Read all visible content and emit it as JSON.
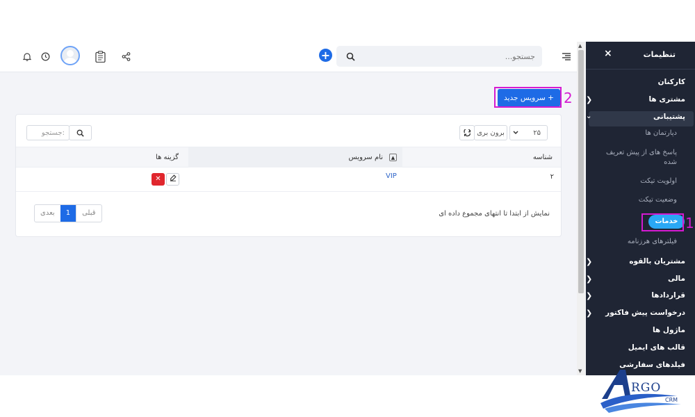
{
  "topbar": {
    "search_placeholder": "جستجو...",
    "icons": [
      "menu-icon",
      "search-icon",
      "add-icon",
      "share-icon",
      "clipboard-icon",
      "avatar",
      "clock-icon",
      "bell-icon"
    ]
  },
  "sidebar": {
    "title": "تنظیمات",
    "close": "×",
    "items": [
      {
        "label": "کارکنان"
      },
      {
        "label": "مشتری ها"
      },
      {
        "label": "پشتیبانی"
      },
      {
        "label": "دپارتمان ها"
      },
      {
        "label": "پاسخ های از پیش تعریف شده"
      },
      {
        "label": "اولویت تیکت"
      },
      {
        "label": "وضعیت تیکت"
      },
      {
        "label": "خدمات"
      },
      {
        "label": "فیلترهای هرزنامه"
      },
      {
        "label": "مشتریان بالقوه"
      },
      {
        "label": "مالی"
      },
      {
        "label": "قراردادها"
      },
      {
        "label": "درخواست پیش فاکتور"
      },
      {
        "label": "ماژول ها"
      },
      {
        "label": "قالب های ایمیل"
      },
      {
        "label": "فیلدهای سفارشی"
      }
    ]
  },
  "annotations": {
    "one": "1",
    "two": "2"
  },
  "main": {
    "new_button": "+ سرویس جدید",
    "page_length": "۲۵",
    "export_label": "برون بری",
    "table_search_placeholder": "جستجو:",
    "columns": {
      "id": "شناسه",
      "name": "نام سرویس",
      "options": "گزینه ها"
    },
    "rows": [
      {
        "id": "۲",
        "name": "VIP"
      }
    ],
    "info": "نمایش از ابتدا تا انتهای مجموع داده ای",
    "pager": {
      "prev": "قبلی",
      "current": "1",
      "next": "بعدی"
    }
  },
  "logo": {
    "text": "RGO",
    "sub": "CRM"
  },
  "colors": {
    "accent": "#1e6be6",
    "sidebar_bg": "#1f2534",
    "pill": "#2aa8f5",
    "danger": "#e0262d",
    "marker": "#d51ad1"
  }
}
